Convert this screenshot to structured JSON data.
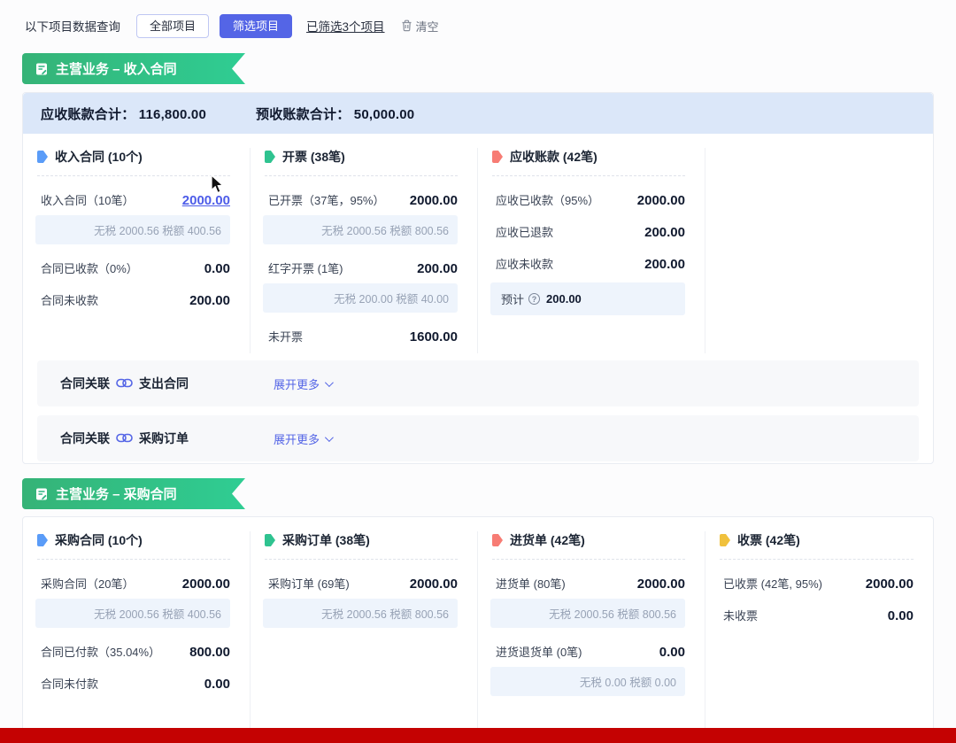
{
  "colors": {
    "accent_indigo": "#5465e6",
    "banner_gradient_start": "#35b377",
    "banner_gradient_end": "#2fcd93",
    "summary_bg": "#dbe7f9",
    "tax_bg": "#eef4fc",
    "link_blue": "#4d5ce8",
    "bottom_bar_red": "#c40202",
    "tag_blue": "#5a9cf8",
    "tag_green": "#2fc390",
    "tag_red": "#f77c74",
    "tag_yellow": "#f0c13d"
  },
  "filter_bar": {
    "label": "以下项目数据查询",
    "all_button": "全部项目",
    "filter_button": "筛选项目",
    "filtered_link": "已筛选3个项目",
    "clear_label": "清空"
  },
  "sections": [
    {
      "banner": "主营业务 – 收入合同",
      "summary": [
        {
          "label": "应收账款合计：",
          "value": "116,800.00"
        },
        {
          "label": "预收账款合计：",
          "value": "50,000.00"
        }
      ],
      "columns": [
        {
          "title": "收入合同 (10个)",
          "accent": "#5a9cf8",
          "rows": [
            {
              "kind": "item",
              "label": "收入合同（10笔）",
              "value": "2000.00",
              "link": true
            },
            {
              "kind": "tax",
              "text": "无税 2000.56 税额 400.56"
            },
            {
              "kind": "item",
              "label": "合同已收款（0%）",
              "value": "0.00"
            },
            {
              "kind": "item",
              "label": "合同未收款",
              "value": "200.00"
            }
          ]
        },
        {
          "title": "开票 (38笔)",
          "accent": "#2fc390",
          "rows": [
            {
              "kind": "item",
              "label": "已开票（37笔，95%）",
              "value": "2000.00"
            },
            {
              "kind": "tax",
              "text": "无税 2000.56 税额 800.56"
            },
            {
              "kind": "item",
              "label": "红字开票 (1笔)",
              "value": "200.00"
            },
            {
              "kind": "tax",
              "text": "无税 200.00 税额 40.00"
            },
            {
              "kind": "item",
              "label": "未开票",
              "value": "1600.00"
            }
          ]
        },
        {
          "title": "应收账款 (42笔)",
          "accent": "#f77c74",
          "rows": [
            {
              "kind": "item",
              "label": "应收已收款（95%）",
              "value": "2000.00"
            },
            {
              "kind": "item",
              "label": "应收已退款",
              "value": "200.00"
            },
            {
              "kind": "item",
              "label": "应收未收款",
              "value": "200.00"
            },
            {
              "kind": "note",
              "label": "预计",
              "value": "200.00"
            }
          ]
        },
        {
          "title": "",
          "accent": "",
          "rows": []
        }
      ],
      "relations": [
        {
          "prefix": "合同关联",
          "target": "支出合同",
          "expand": "展开更多"
        },
        {
          "prefix": "合同关联",
          "target": "采购订单",
          "expand": "展开更多"
        }
      ]
    },
    {
      "banner": "主营业务 – 采购合同",
      "summary": [],
      "columns": [
        {
          "title": "采购合同 (10个)",
          "accent": "#5a9cf8",
          "rows": [
            {
              "kind": "item",
              "label": "采购合同（20笔）",
              "value": "2000.00"
            },
            {
              "kind": "tax",
              "text": "无税 2000.56 税额 400.56"
            },
            {
              "kind": "item",
              "label": "合同已付款（35.04%）",
              "value": "800.00"
            },
            {
              "kind": "item",
              "label": "合同未付款",
              "value": "0.00"
            }
          ]
        },
        {
          "title": "采购订单 (38笔)",
          "accent": "#2fc390",
          "rows": [
            {
              "kind": "item",
              "label": "采购订单 (69笔)",
              "value": "2000.00"
            },
            {
              "kind": "tax",
              "text": "无税 2000.56 税额 800.56"
            }
          ]
        },
        {
          "title": "进货单 (42笔)",
          "accent": "#f77c74",
          "rows": [
            {
              "kind": "item",
              "label": "进货单 (80笔)",
              "value": "2000.00"
            },
            {
              "kind": "tax",
              "text": "无税 2000.56 税额 800.56"
            },
            {
              "kind": "item",
              "label": "进货退货单 (0笔)",
              "value": "0.00"
            },
            {
              "kind": "tax",
              "text": "无税 0.00 税额 0.00"
            }
          ]
        },
        {
          "title": "收票 (42笔)",
          "accent": "#f0c13d",
          "rows": [
            {
              "kind": "item",
              "label": "已收票 (42笔, 95%)",
              "value": "2000.00"
            },
            {
              "kind": "item",
              "label": "未收票",
              "value": "0.00"
            }
          ]
        }
      ],
      "relations": []
    }
  ]
}
